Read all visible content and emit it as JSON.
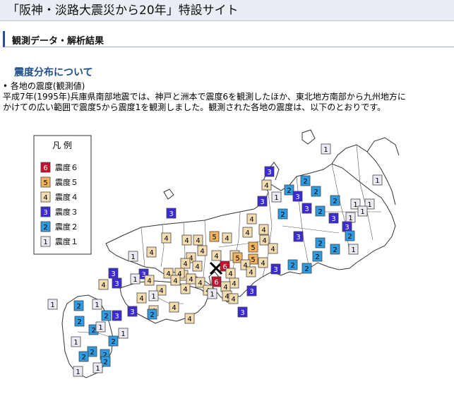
{
  "header": {
    "title": "「阪神・淡路大震災から20年」特設サイト"
  },
  "section": {
    "title": "観測データ・解析結果"
  },
  "sub": {
    "heading": "震度分布について"
  },
  "intro": {
    "bullet": "• 各地の震度(観測値)",
    "line1": "平成7年(1995年)兵庫県南部地震では、神戸と洲本で震度6を観測したほか、東北地方南部から九州地方に",
    "line2": "かけての広い範囲で震度5から震度1を観測しました。観測された各地の震度は、以下のとおりです。"
  },
  "legend": {
    "title": "凡 例",
    "items": [
      {
        "digit": "6",
        "label": "震度６",
        "color": "#c8102e",
        "text_color": "#ffffff"
      },
      {
        "digit": "5",
        "label": "震度５",
        "color": "#f3b35c",
        "text_color": "#000000"
      },
      {
        "digit": "4",
        "label": "震度４",
        "color": "#f3ddb0",
        "text_color": "#000000"
      },
      {
        "digit": "3",
        "label": "震度３",
        "color": "#3c2ad6",
        "text_color": "#ffffff"
      },
      {
        "digit": "2",
        "label": "震度２",
        "color": "#2f9be0",
        "text_color": "#000000"
      },
      {
        "digit": "1",
        "label": "震度１",
        "color": "#ecebf4",
        "text_color": "#000000"
      }
    ]
  },
  "map": {
    "epicenter_icon": "cross-epicenter-icon"
  }
}
